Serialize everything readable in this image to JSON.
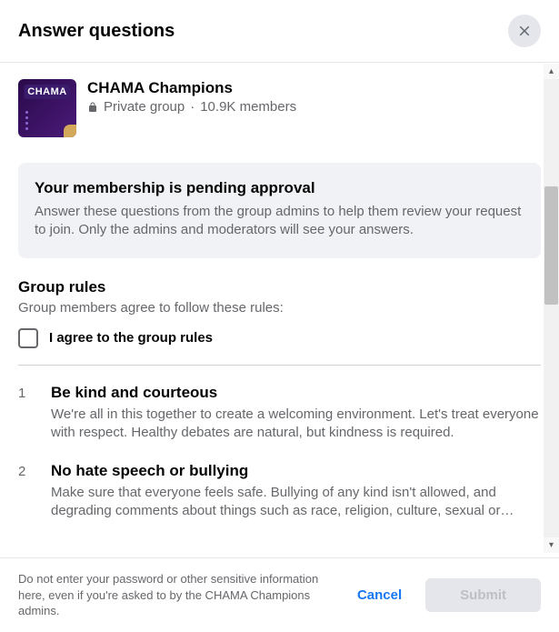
{
  "header": {
    "title": "Answer questions"
  },
  "group": {
    "name": "CHAMA Champions",
    "thumb_text": "CHAMA",
    "privacy": "Private group",
    "separator": "·",
    "members": "10.9K members"
  },
  "pending": {
    "title": "Your membership is pending approval",
    "desc": "Answer these questions from the group admins to help them review your request to join. Only the admins and moderators will see your answers."
  },
  "rules": {
    "title": "Group rules",
    "subtitle": "Group members agree to follow these rules:",
    "agree_label": "I agree to the group rules",
    "items": [
      {
        "num": "1",
        "title": "Be kind and courteous",
        "desc": "We're all in this together to create a welcoming environment. Let's treat everyone with respect. Healthy debates are natural, but kindness is required."
      },
      {
        "num": "2",
        "title": "No hate speech or bullying",
        "desc": "Make sure that everyone feels safe. Bullying of any kind isn't allowed, and degrading comments about things such as race, religion, culture, sexual or…"
      }
    ]
  },
  "footer": {
    "warning": "Do not enter your password or other sensitive information here, even if you're asked to by the CHAMA Champions admins.",
    "cancel": "Cancel",
    "submit": "Submit"
  }
}
